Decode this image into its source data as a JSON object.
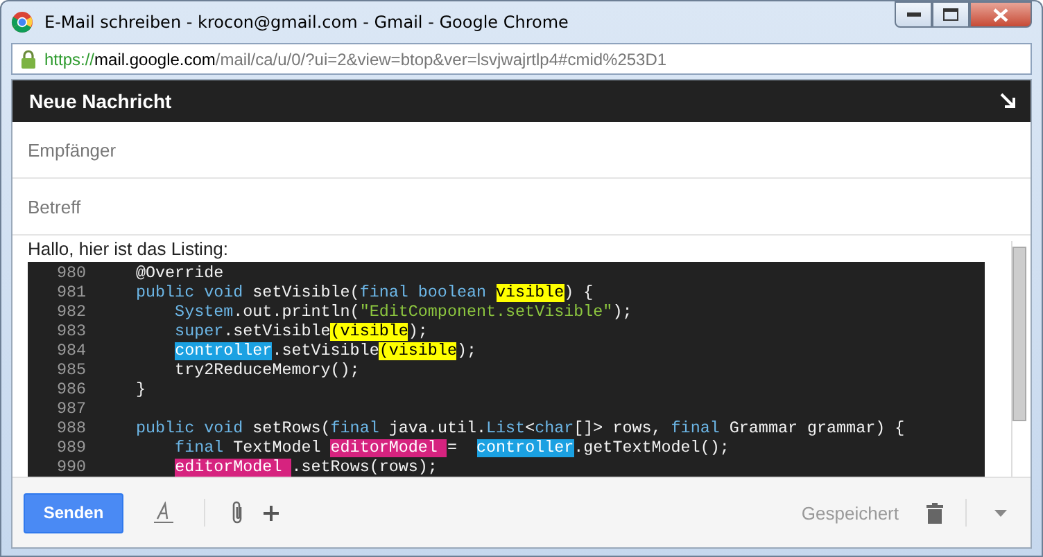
{
  "window": {
    "title": "E-Mail schreiben - krocon@gmail.com - Gmail - Google Chrome"
  },
  "address_bar": {
    "scheme": "https://",
    "host": "mail.google.com",
    "path": "/mail/ca/u/0/?ui=2&view=btop&ver=lsvjwajrtlp4#cmid%253D1"
  },
  "compose": {
    "title": "Neue Nachricht",
    "recipients": {
      "placeholder": "Empfänger"
    },
    "subject": {
      "placeholder": "Betreff"
    },
    "body_text": "Hallo, hier ist das Listing:",
    "listing": [
      {
        "number": "980",
        "tokens": [
          {
            "kind": "plain",
            "text": "@Override"
          }
        ]
      },
      {
        "number": "981",
        "tokens": [
          {
            "kind": "keyword",
            "text": "public void"
          },
          {
            "kind": "plain",
            "text": " setVisible("
          },
          {
            "kind": "keyword",
            "text": "final boolean"
          },
          {
            "kind": "plain",
            "text": " visible",
            "color": "#ffff00"
          },
          {
            "kind": "plain",
            "text": ") {"
          }
        ]
      },
      {
        "number": "982",
        "tokens": [
          {
            "kind": "keyword",
            "text": "    System"
          },
          {
            "kind": "plain",
            "text": ".out.println("
          },
          {
            "kind": "string",
            "text": "\"EditComponent.setVisible\""
          },
          {
            "kind": "plain",
            "text": ");"
          }
        ]
      },
      {
        "number": "983",
        "tokens": [
          {
            "kind": "keyword",
            "text": "    super"
          },
          {
            "kind": "plain",
            "text": ".setVisible"
          },
          {
            "kind": "plain",
            "text": "(visible",
            "color": "#ffff00"
          },
          {
            "kind": "plain",
            "text": ");"
          }
        ]
      },
      {
        "number": "984",
        "tokens": [
          {
            "kind": "keyword",
            "text": "    controller",
            "color": "#1ba1e2"
          },
          {
            "kind": "plain",
            "text": ".setVisible"
          },
          {
            "kind": "plain",
            "text": "(visible",
            "color": "#ffff00"
          },
          {
            "kind": "plain",
            "text": ");"
          }
        ]
      },
      {
        "number": "985",
        "tokens": [
          {
            "kind": "plain",
            "text": "    try2ReduceMemory();"
          }
        ]
      },
      {
        "number": "986",
        "tokens": [
          {
            "kind": "plain",
            "text": "}"
          }
        ]
      },
      {
        "number": "987"
      },
      {
        "number": "988",
        "tokens": [
          {
            "kind": "keyword",
            "text": "public void"
          },
          {
            "kind": "plain",
            "text": " setRows("
          },
          {
            "kind": "keyword",
            "text": "final"
          },
          {
            "kind": "plain",
            "text": " java.util."
          },
          {
            "kind": "keyword",
            "text": "List"
          },
          {
            "kind": "plain",
            "text": "<"
          },
          {
            "kind": "keyword",
            "text": "char"
          },
          {
            "kind": "plain",
            "text": "[]> rows, "
          },
          {
            "kind": "keyword",
            "text": "final"
          },
          {
            "kind": "plain",
            "text": " Grammar grammar) {"
          }
        ]
      },
      {
        "number": "989",
        "tokens": [
          {
            "kind": "keyword",
            "text": "    final"
          },
          {
            "kind": "plain",
            "text": " TextModel"
          },
          {
            "kind": "plain",
            "text": " editorModel ",
            "color": "#d6237f"
          },
          {
            "kind": "plain",
            "text": "= "
          },
          {
            "kind": "plain",
            "text": " controller",
            "color": "#1ba1e2"
          },
          {
            "kind": "plain",
            "text": ".getTextModel();"
          }
        ]
      },
      {
        "number": "990",
        "tokens": [
          {
            "kind": "plain",
            "text": "    editorModel ",
            "color": "#d6237f"
          },
          {
            "kind": "plain",
            "text": ".setRows(rows);"
          }
        ]
      }
    ],
    "send_button": "Senden",
    "status": "Gespeichert"
  }
}
